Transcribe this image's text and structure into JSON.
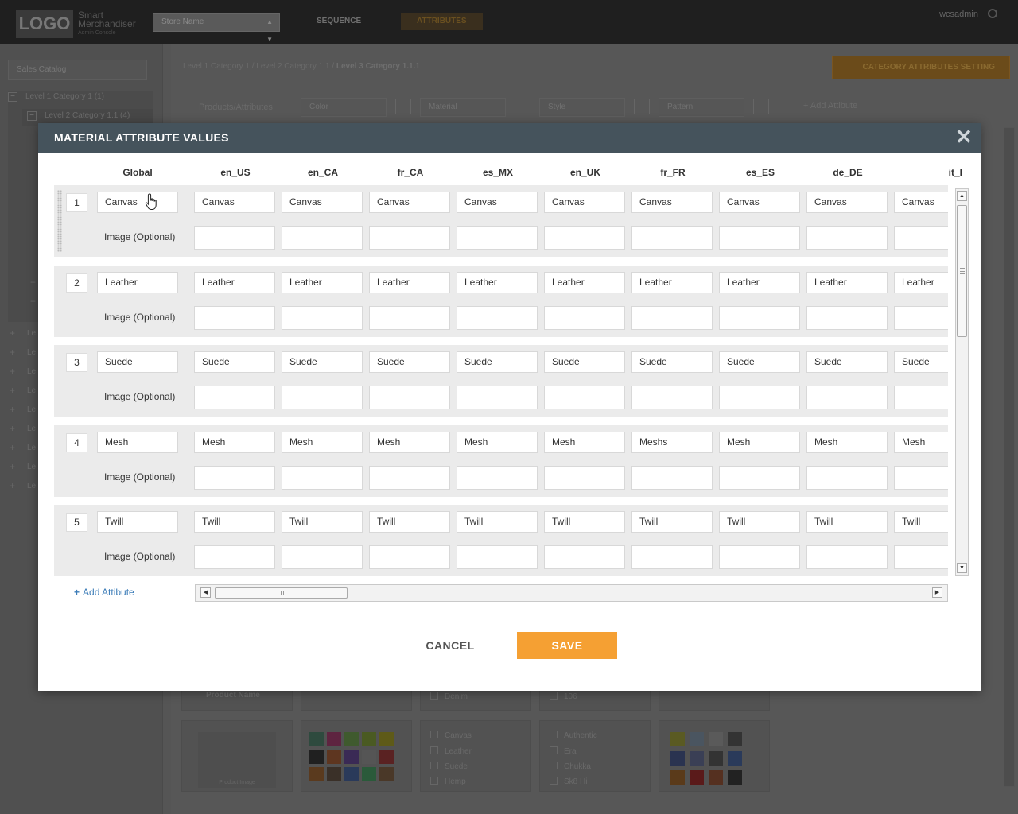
{
  "app": {
    "logo": "LOGO",
    "brand_line1": "Smart",
    "brand_line2": "Merchandiser",
    "brand_line3": "Admin Console",
    "store_placeholder": "Store Name",
    "nav": [
      {
        "label": "SEQUENCE",
        "active": false
      },
      {
        "label": "ATTRIBUTES",
        "active": true
      }
    ],
    "user": "wcsadmin",
    "catalog_select": "Sales Catalog",
    "tree": [
      {
        "label": "Level 1 Category 1 (1)",
        "expanded": true
      },
      {
        "label": "Level 2 Category 1.1 (4)",
        "expanded": true
      }
    ],
    "tree_collapsed_prefix": "Le",
    "breadcrumb": {
      "parts": "Level 1 Category 1 / Level 2 Category 1.1 / ",
      "current": "Level 3 Category 1.1.1"
    },
    "category_attributes_button": "CATEGORY ATTRIBUTES SETTING",
    "toolbar": {
      "label": "Products/Attributes",
      "selects": [
        "Color",
        "Material",
        "Style",
        "Pattern"
      ],
      "add_attribute": "+ Add Attibute"
    },
    "background_grid": {
      "product_name": "Product Name",
      "product_image": "Product Image",
      "material_items": [
        {
          "label": "Denim",
          "checked": false
        },
        {
          "label": "Canvas",
          "checked": false
        },
        {
          "label": "Leather",
          "checked": true
        },
        {
          "label": "Suede",
          "checked": false
        },
        {
          "label": "Hemp",
          "checked": true
        }
      ],
      "style_items": [
        {
          "label": "106",
          "checked": false
        },
        {
          "label": "Authentic",
          "checked": false
        },
        {
          "label": "Era",
          "checked": false
        },
        {
          "label": "Chukka",
          "checked": true
        },
        {
          "label": "Sk8 Hi",
          "checked": true
        }
      ]
    }
  },
  "modal": {
    "title": "MATERIAL ATTRIBUTE VALUES",
    "columns": [
      "Global",
      "en_US",
      "en_CA",
      "fr_CA",
      "es_MX",
      "en_UK",
      "fr_FR",
      "es_ES",
      "de_DE",
      "it_I"
    ],
    "image_label": "Image (Optional)",
    "rows": [
      {
        "number": "1",
        "global": "Canvas",
        "locales": [
          "Canvas",
          "Canvas",
          "Canvas",
          "Canvas",
          "Canvas",
          "Canvas",
          "Canvas",
          "Canvas",
          "Canvas"
        ]
      },
      {
        "number": "2",
        "global": "Leather",
        "locales": [
          "Leather",
          "Leather",
          "Leather",
          "Leather",
          "Leather",
          "Leather",
          "Leather",
          "Leather",
          "Leather"
        ]
      },
      {
        "number": "3",
        "global": "Suede",
        "locales": [
          "Suede",
          "Suede",
          "Suede",
          "Suede",
          "Suede",
          "Suede",
          "Suede",
          "Suede",
          "Suede"
        ]
      },
      {
        "number": "4",
        "global": "Mesh",
        "locales": [
          "Mesh",
          "Mesh",
          "Mesh",
          "Mesh",
          "Mesh",
          "Meshs",
          "Mesh",
          "Mesh",
          "Mesh"
        ]
      },
      {
        "number": "5",
        "global": "Twill",
        "locales": [
          "Twill",
          "Twill",
          "Twill",
          "Twill",
          "Twill",
          "Twill",
          "Twill",
          "Twill",
          "Twill"
        ]
      }
    ],
    "add_attribute": "Add Attibute",
    "cancel": "CANCEL",
    "save": "SAVE",
    "accent_color": "#f5a033",
    "header_color": "#45535c",
    "link_color": "#3d7db8"
  }
}
